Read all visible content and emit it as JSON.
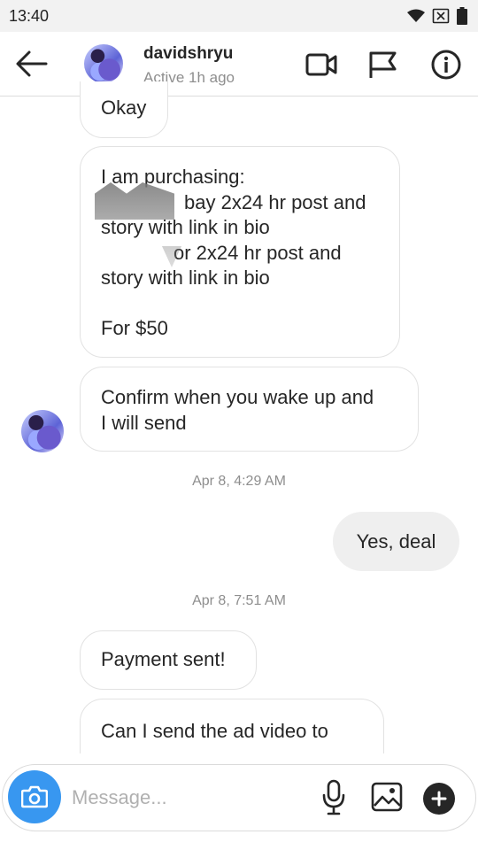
{
  "status_bar": {
    "time": "13:40"
  },
  "header": {
    "username": "davidshryu",
    "status": "Active 1h ago"
  },
  "messages": {
    "okay": "Okay",
    "purchase_lines": [
      "I am purchasing:",
      "bay 2x24 hr post and",
      "story with link in bio",
      "or 2x24 hr post and",
      "story with link in bio",
      "",
      "For $50"
    ],
    "confirm_lines": [
      "Confirm when you wake up and",
      "I will send"
    ],
    "timestamp_1": "Apr 8, 4:29 AM",
    "sent_reply": "Yes, deal",
    "timestamp_2": "Apr 8, 7:51 AM",
    "payment": "Payment sent!",
    "ad_video": "Can I send the ad video to"
  },
  "composer": {
    "placeholder": "Message..."
  }
}
